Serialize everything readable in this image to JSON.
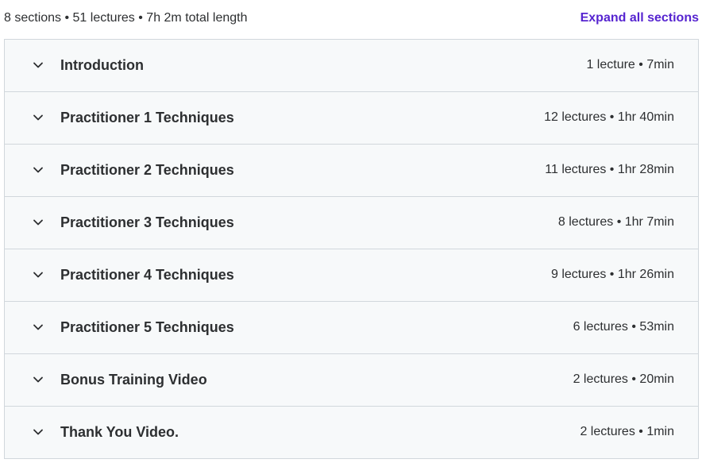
{
  "summary": {
    "text": "8 sections • 51 lectures • 7h 2m total length",
    "expand_all_label": "Expand all sections"
  },
  "sections": [
    {
      "title": "Introduction",
      "meta": "1 lecture • 7min",
      "icon": "chevron-down-icon"
    },
    {
      "title": "Practitioner 1 Techniques",
      "meta": "12 lectures • 1hr 40min",
      "icon": "chevron-down-icon"
    },
    {
      "title": "Practitioner 2 Techniques",
      "meta": "11 lectures • 1hr 28min",
      "icon": "chevron-down-icon"
    },
    {
      "title": "Practitioner 3 Techniques",
      "meta": "8 lectures • 1hr 7min",
      "icon": "chevron-down-icon"
    },
    {
      "title": "Practitioner 4 Techniques",
      "meta": "9 lectures • 1hr 26min",
      "icon": "chevron-down-icon"
    },
    {
      "title": "Practitioner 5 Techniques",
      "meta": "6 lectures • 53min",
      "icon": "chevron-down-icon"
    },
    {
      "title": "Bonus Training Video",
      "meta": "2 lectures • 20min",
      "icon": "chevron-down-icon"
    },
    {
      "title": "Thank You Video.",
      "meta": "2 lectures • 1min",
      "icon": "chevron-down-icon"
    }
  ],
  "colors": {
    "accent": "#5624d0",
    "text": "#2d2f31",
    "row_background": "#f7f9fa",
    "border": "#d1d7dc"
  }
}
